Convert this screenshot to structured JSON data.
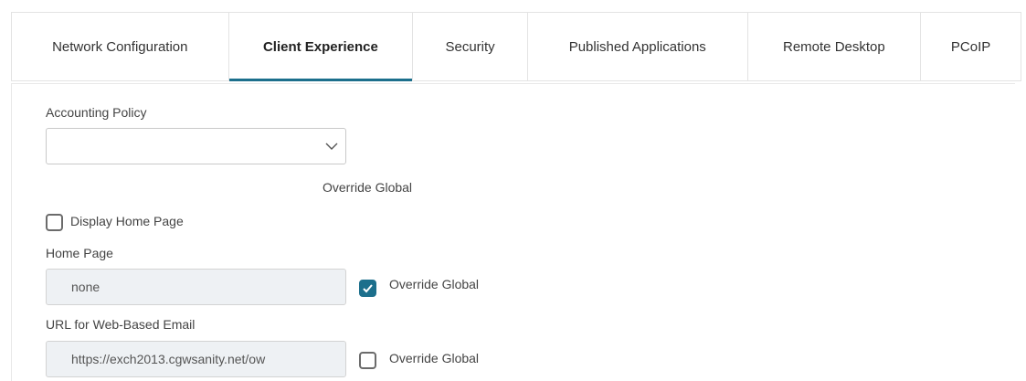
{
  "tabs": [
    {
      "label": "Network Configuration",
      "active": false
    },
    {
      "label": "Client Experience",
      "active": true
    },
    {
      "label": "Security",
      "active": false
    },
    {
      "label": "Published Applications",
      "active": false
    },
    {
      "label": "Remote Desktop",
      "active": false
    },
    {
      "label": "PCoIP",
      "active": false
    }
  ],
  "accounting_policy": {
    "label": "Accounting Policy",
    "value": "",
    "override_label": "Override Global"
  },
  "display_home_page": {
    "label": "Display Home Page",
    "checked": false
  },
  "home_page": {
    "label": "Home Page",
    "value": "none",
    "override_label": "Override Global",
    "override_checked": true
  },
  "web_email": {
    "label": "URL for Web-Based Email",
    "value": "https://exch2013.cgwsanity.net/ow",
    "override_label": "Override Global",
    "override_checked": false
  },
  "colors": {
    "accent": "#1c6f8c",
    "border": "#e3e3e3",
    "input_disabled_bg": "#eef1f4"
  }
}
